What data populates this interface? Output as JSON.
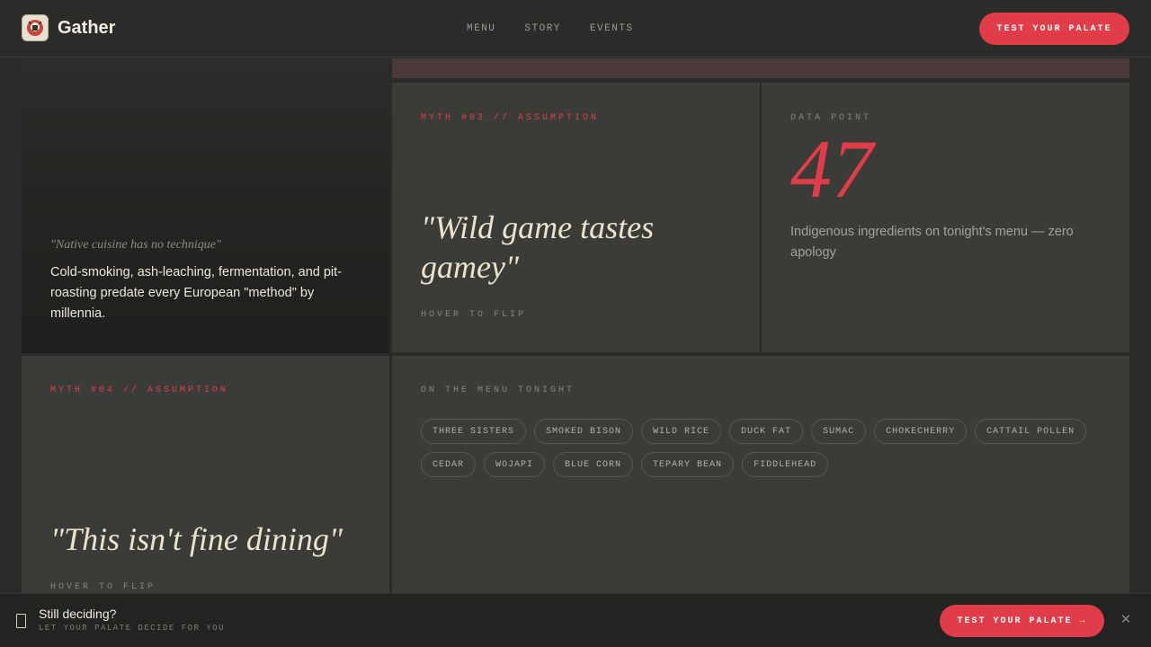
{
  "header": {
    "brand": "Gather",
    "nav": [
      "MENU",
      "STORY",
      "EVENTS"
    ],
    "cta": "TEST YOUR PALATE"
  },
  "card_technique": {
    "myth_quote": "\"Native cuisine has no technique\"",
    "fact": "Cold-smoking, ash-leaching, fermentation, and pit-roasting predate every European \"method\" by millennia."
  },
  "card_myth3": {
    "label": "MYTH #03 // ASSUMPTION",
    "quote": "\"Wild game tastes gamey\"",
    "hint": "HOVER TO FLIP"
  },
  "card_data": {
    "label": "DATA POINT",
    "number": "47",
    "description": "Indigenous ingredients on tonight's menu — zero apology"
  },
  "card_myth4": {
    "label": "MYTH #04 // ASSUMPTION",
    "quote": "\"This isn't fine dining\"",
    "hint": "HOVER TO FLIP"
  },
  "card_menu": {
    "label": "ON THE MENU TONIGHT",
    "ingredients": [
      "THREE SISTERS",
      "SMOKED BISON",
      "WILD RICE",
      "DUCK FAT",
      "SUMAC",
      "CHOKECHERRY",
      "CATTAIL POLLEN",
      "CEDAR",
      "WOJAPI",
      "BLUE CORN",
      "TEPARY BEAN",
      "FIDDLEHEAD"
    ]
  },
  "bottom_bar": {
    "title": "Still deciding?",
    "subtitle": "LET YOUR PALATE DECIDE FOR YOU",
    "cta": "TEST YOUR PALATE →",
    "close": "✕"
  },
  "colors": {
    "accent": "#e03c49",
    "background": "#2a2b28",
    "card": "#3b3c37"
  },
  "icons": {
    "logo": "gather-logo-icon",
    "bottom": "document-icon",
    "close": "close-icon"
  }
}
